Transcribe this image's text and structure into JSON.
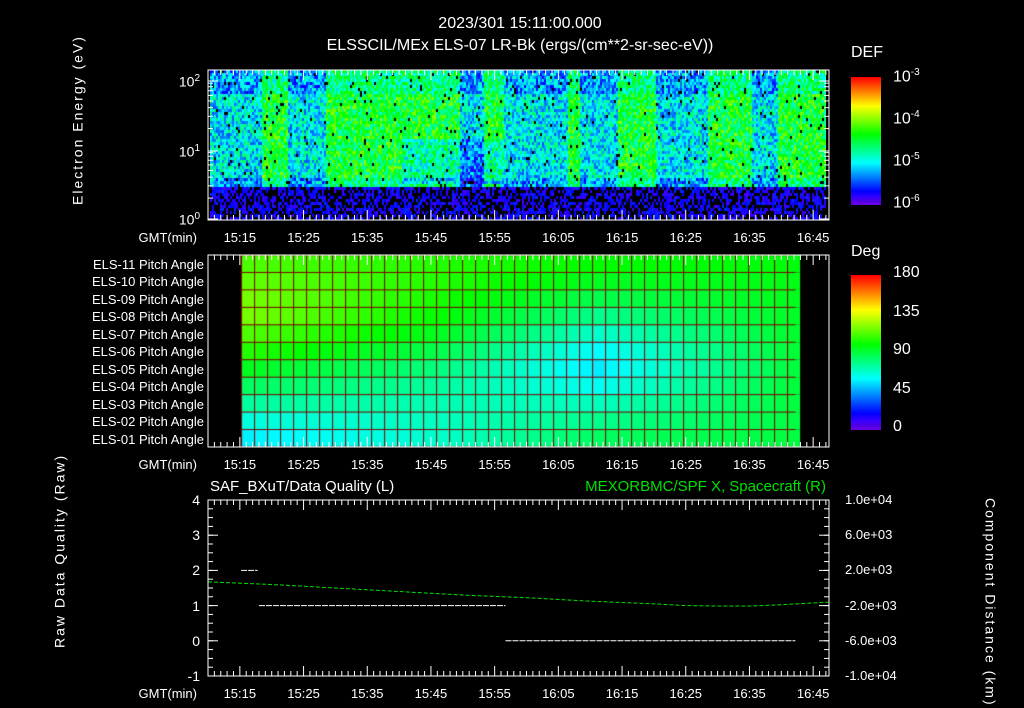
{
  "header": {
    "timestamp": "2023/301 15:11:00.000",
    "title": "ELSSCIL/MEx ELS-07 LR-Bk  (ergs/(cm**2-sr-sec-eV))"
  },
  "colors": {
    "green_series": "#00e000",
    "axis": "#ffffff",
    "background": "#000000",
    "grid": "#800000"
  },
  "chart_data": [
    {
      "type": "heatmap",
      "title": "ELSSCIL/MEx ELS-07 LR-Bk  (ergs/(cm**2-sr-sec-eV))",
      "ylabel": "Electron Energy (eV)",
      "xlabel": "GMT(min)",
      "yscale": "log",
      "ylim": [
        1,
        180
      ],
      "yticks": [
        "10",
        "10",
        "10"
      ],
      "ytick_exponents": [
        "0",
        "1",
        "2"
      ],
      "xticks": [
        "15:15",
        "15:25",
        "15:35",
        "15:45",
        "15:55",
        "16:05",
        "16:15",
        "16:25",
        "16:35",
        "16:45"
      ],
      "xlim_minutes_after_1510": [
        0,
        97.5
      ],
      "colorbar": {
        "label": "DEF",
        "scale": "log",
        "range": [
          1e-06,
          0.001
        ],
        "tick_base": "10",
        "tick_exponents": [
          "-3",
          "-4",
          "-5",
          "-6"
        ]
      },
      "bright_intervals_min_after_1510": [
        [
          8,
          12
        ],
        [
          18,
          39
        ],
        [
          43,
          46
        ],
        [
          56,
          58
        ],
        [
          64,
          70
        ],
        [
          78,
          85
        ],
        [
          89,
          97
        ]
      ]
    },
    {
      "type": "heatmap",
      "title": "Pitch Angle",
      "xlabel": "GMT(min)",
      "rows": [
        "ELS-11 Pitch Angle",
        "ELS-10 Pitch Angle",
        "ELS-09 Pitch Angle",
        "ELS-08 Pitch Angle",
        "ELS-07 Pitch Angle",
        "ELS-06 Pitch Angle",
        "ELS-05 Pitch Angle",
        "ELS-04 Pitch Angle",
        "ELS-03 Pitch Angle",
        "ELS-02 Pitch Angle",
        "ELS-01 Pitch Angle"
      ],
      "xticks": [
        "15:15",
        "15:25",
        "15:35",
        "15:45",
        "15:55",
        "16:05",
        "16:15",
        "16:25",
        "16:35",
        "16:45"
      ],
      "data_time_range_min_after_1510": [
        5.2,
        92.2
      ],
      "anchor_times_min_after_1510": [
        5,
        35,
        60,
        92
      ],
      "values_deg": [
        [
          112,
          105,
          100,
          98
        ],
        [
          115,
          105,
          95,
          97
        ],
        [
          118,
          103,
          88,
          96
        ],
        [
          118,
          100,
          78,
          95
        ],
        [
          112,
          95,
          68,
          94
        ],
        [
          105,
          88,
          60,
          93
        ],
        [
          95,
          80,
          57,
          92
        ],
        [
          85,
          75,
          62,
          92
        ],
        [
          75,
          72,
          70,
          91
        ],
        [
          65,
          70,
          78,
          90
        ],
        [
          58,
          68,
          85,
          90
        ]
      ],
      "colorbar": {
        "label": "Deg",
        "range": [
          0,
          180
        ],
        "ticks": [
          "180",
          "135",
          "90",
          "45",
          "0"
        ]
      }
    },
    {
      "type": "line",
      "title_left": "SAF_BXuT/Data Quality (L)",
      "title_right": "MEXORBMC/SPF X, Spacecraft (R)",
      "ylabel_left": "Raw Data Quality (Raw)",
      "ylabel_right": "Component Distance (km)",
      "xlabel": "GMT(min)",
      "ylim_left": [
        -1,
        4
      ],
      "yticks_left": [
        "4",
        "3",
        "2",
        "1",
        "0",
        "-1"
      ],
      "ylim_right": [
        -10000,
        10000
      ],
      "yticks_right": [
        "1.0e+04",
        "6.0e+03",
        "2.0e+03",
        "-2.0e+03",
        "-6.0e+03",
        "-1.0e+04"
      ],
      "xticks": [
        "15:15",
        "15:25",
        "15:35",
        "15:45",
        "15:55",
        "16:05",
        "16:15",
        "16:25",
        "16:35",
        "16:45"
      ],
      "series": [
        {
          "name": "Data Quality",
          "axis": "left",
          "color": "#ffffff",
          "segments": [
            {
              "t": [
                5.2,
                7.8
              ],
              "y": 2
            },
            {
              "t": [
                8,
                46.7
              ],
              "y": 1
            },
            {
              "t": [
                46.7,
                92.2
              ],
              "y": 0
            }
          ]
        },
        {
          "name": "SPF X",
          "axis": "right",
          "color": "#00e000",
          "t": [
            0,
            10,
            20,
            30,
            40,
            50,
            60,
            70,
            75,
            80,
            85,
            90,
            97.5
          ],
          "y": [
            700,
            400,
            0,
            -400,
            -800,
            -1100,
            -1500,
            -1800,
            -2000,
            -2050,
            -2050,
            -1900,
            -1600
          ]
        }
      ]
    }
  ]
}
